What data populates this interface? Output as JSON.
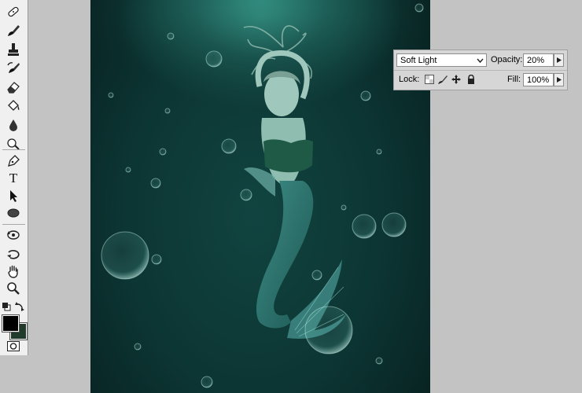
{
  "toolbar": {
    "tools": [
      {
        "name": "healing-brush-icon",
        "group": 1
      },
      {
        "name": "brush-icon",
        "group": 1
      },
      {
        "name": "clone-stamp-icon",
        "group": 1
      },
      {
        "name": "history-brush-icon",
        "group": 1
      },
      {
        "name": "eraser-icon",
        "group": 1
      },
      {
        "name": "paint-bucket-icon",
        "group": 1
      },
      {
        "name": "blur-icon",
        "group": 1
      },
      {
        "name": "dodge-icon",
        "group": 1
      },
      {
        "name": "pen-icon",
        "group": 2
      },
      {
        "name": "type-icon",
        "group": 2
      },
      {
        "name": "path-selection-icon",
        "group": 2
      },
      {
        "name": "ellipse-shape-icon",
        "group": 2
      },
      {
        "name": "3d-rotate-icon",
        "group": 3
      },
      {
        "name": "3d-orbit-icon",
        "group": 3
      },
      {
        "name": "hand-icon",
        "group": 3
      },
      {
        "name": "zoom-icon",
        "group": 3
      }
    ],
    "type_tool_glyph": "T",
    "foreground_color": "#000000",
    "background_color": "#203a2c"
  },
  "layers_panel": {
    "blend_mode": "Soft Light",
    "opacity_label": "Opacity:",
    "opacity_value": "20%",
    "lock_label": "Lock:",
    "fill_label": "Fill:",
    "fill_value": "100%",
    "lock_icons": [
      "lock-transparent-pixels-icon",
      "lock-image-pixels-icon",
      "lock-position-icon",
      "lock-all-icon"
    ]
  }
}
